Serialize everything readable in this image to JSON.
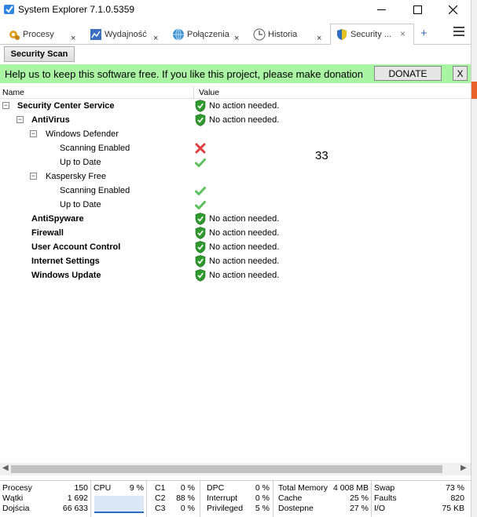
{
  "window": {
    "title": "System Explorer 7.1.0.5359",
    "minimize_icon": "minimize-icon",
    "maximize_icon": "maximize-icon",
    "close_icon": "close-icon"
  },
  "tabs": [
    {
      "label": "Procesy",
      "icon": "gears-icon",
      "close": "×"
    },
    {
      "label": "Wydajność",
      "icon": "performance-icon",
      "close": "×"
    },
    {
      "label": "Połączenia",
      "icon": "globe-icon",
      "close": "×"
    },
    {
      "label": "Historia",
      "icon": "clock-icon",
      "close": "×"
    },
    {
      "label": "Security ...",
      "icon": "shield-icon",
      "close": "×"
    }
  ],
  "tabbar": {
    "add": "+",
    "menu_icon": "hamburger-menu-icon"
  },
  "toolbar": {
    "scan_label": "Security Scan"
  },
  "donate": {
    "message": "Help us to keep this software free.  If you like this project, please make donation",
    "button": "DONATE",
    "close": "X"
  },
  "list": {
    "col_name": "Name",
    "col_value": "Value",
    "rows": [
      {
        "name": "Security Center Service",
        "bold": true,
        "level": 0,
        "expander": "−",
        "status": "ok",
        "value": "No action needed."
      },
      {
        "name": "AntiVirus",
        "bold": true,
        "level": 1,
        "expander": "−",
        "status": "ok",
        "value": "No action needed."
      },
      {
        "name": "Windows Defender",
        "bold": false,
        "level": 2,
        "expander": "−",
        "status": "",
        "value": ""
      },
      {
        "name": "Scanning Enabled",
        "bold": false,
        "level": 3,
        "expander": "",
        "status": "cross",
        "value": ""
      },
      {
        "name": "Up to Date",
        "bold": false,
        "level": 3,
        "expander": "",
        "status": "check",
        "value": ""
      },
      {
        "name": "Kaspersky Free",
        "bold": false,
        "level": 2,
        "expander": "−",
        "status": "",
        "value": ""
      },
      {
        "name": "Scanning Enabled",
        "bold": false,
        "level": 3,
        "expander": "",
        "status": "check",
        "value": ""
      },
      {
        "name": "Up to Date",
        "bold": false,
        "level": 3,
        "expander": "",
        "status": "check",
        "value": ""
      },
      {
        "name": "AntiSpyware",
        "bold": true,
        "level": 1,
        "expander": "",
        "status": "ok",
        "value": "No action needed."
      },
      {
        "name": "Firewall",
        "bold": true,
        "level": 1,
        "expander": "",
        "status": "ok",
        "value": "No action needed."
      },
      {
        "name": "User Account Control",
        "bold": true,
        "level": 1,
        "expander": "",
        "status": "ok",
        "value": "No action needed."
      },
      {
        "name": "Internet Settings",
        "bold": true,
        "level": 1,
        "expander": "",
        "status": "ok",
        "value": "No action needed."
      },
      {
        "name": "Windows Update",
        "bold": true,
        "level": 1,
        "expander": "",
        "status": "ok",
        "value": "No action needed."
      }
    ]
  },
  "overlay_number": "33",
  "statusbar": {
    "procesy_label": "Procesy",
    "procesy": "150",
    "watki_label": "Wątki",
    "watki": "1 692",
    "dojscia_label": "Dojścia",
    "dojscia": "66 633",
    "cpu_label": "CPU",
    "cpu": "9 %",
    "c1_label": "C1",
    "c1": "0 %",
    "c2_label": "C2",
    "c2": "88 %",
    "c3_label": "C3",
    "c3": "0 %",
    "dpc_label": "DPC",
    "dpc": "0 %",
    "interrupt_label": "Interrupt",
    "interrupt": "0 %",
    "privileged_label": "Privileged",
    "privileged": "5 %",
    "total_memory_label": "Total Memory",
    "total_memory": "4 008 MB",
    "cache_label": "Cache",
    "cache": "25 %",
    "dostepne_label": "Dostepne",
    "dostepne": "27 %",
    "swap_label": "Swap",
    "swap": "73 %",
    "faults_label": "Faults",
    "faults": "820",
    "io_label": "I/O",
    "io": "75 KB"
  },
  "colors": {
    "donate_bar": "#aaf5a4",
    "shield_green": "#2e9a2e",
    "cross_red": "#e04040",
    "accent_orange": "#e8632b"
  }
}
